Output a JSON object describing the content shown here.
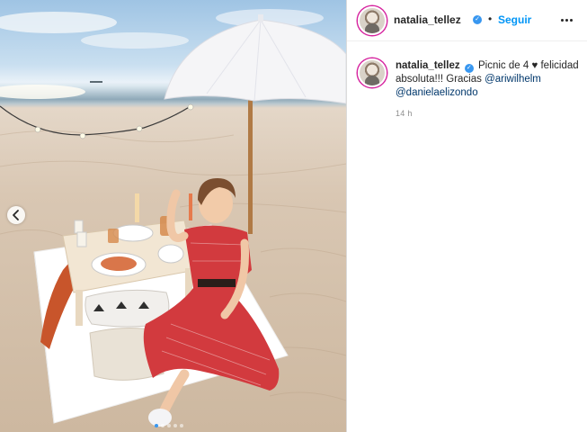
{
  "post": {
    "image_alt": "Woman in red dress sitting on a beach picnic blanket under a white umbrella"
  },
  "header": {
    "username": "natalia_tellez",
    "separator": "•",
    "follow_label": "Seguir",
    "more_icon": "more-horizontal-icon"
  },
  "caption": {
    "username": "natalia_tellez",
    "text_1": "Picnic de 4 ♥ felicidad absoluta!!! Gracias",
    "mention_1": "@ariwilhelm",
    "mention_2": "@danielaelizondo",
    "time": "14 h"
  },
  "carousel": {
    "dots": 5,
    "active_index": 0,
    "prev_icon": "chevron-left-icon"
  },
  "colors": {
    "verified": "#3897f0",
    "follow": "#0095f6",
    "mention": "#00376b",
    "dress_red": "#d23a3e"
  }
}
